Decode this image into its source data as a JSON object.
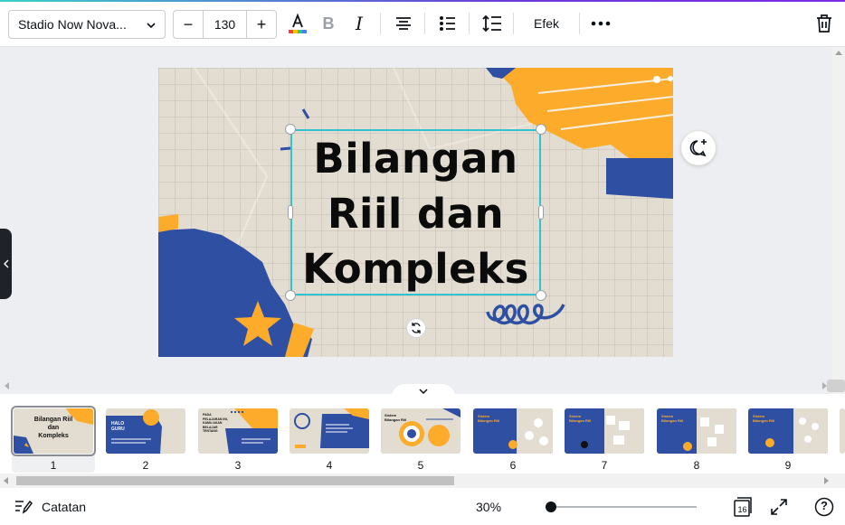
{
  "toolbar": {
    "font_name": "Stadio Now Nova...",
    "font_size": "130",
    "decrease_label": "−",
    "increase_label": "+",
    "effects_label": "Efek",
    "text_color_accent": "#ff3d3d",
    "icons": [
      "text-color-icon",
      "bold-icon",
      "italic-icon",
      "align-center-icon",
      "list-icon",
      "spacing-icon",
      "more-icon",
      "trash-icon"
    ]
  },
  "slide": {
    "title_lines": [
      "Bilangan",
      "Riil dan",
      "Kompleks"
    ],
    "colors": {
      "orange": "#fdab2b",
      "blue": "#2f4fa3",
      "paper": "#e3ddd1"
    }
  },
  "thumbnails": [
    {
      "num": "1",
      "text": "Bilangan Riil dan Kompleks",
      "active": true
    },
    {
      "num": "2",
      "text": "HALO GURU"
    },
    {
      "num": "3",
      "text": "PADA PELAJARAN INI, KAMU AKAN BELAJAR TENTANG"
    },
    {
      "num": "4",
      "text": ""
    },
    {
      "num": "5",
      "text": "Sistem Bilangan Riil"
    },
    {
      "num": "6",
      "text": "Sistem Bilangan Riil"
    },
    {
      "num": "7",
      "text": "Sistem Bilangan Riil"
    },
    {
      "num": "8",
      "text": "Sistem Bilangan Riil"
    },
    {
      "num": "9",
      "text": "Sistem Bilangan Riil"
    }
  ],
  "bottombar": {
    "notes_label": "Catatan",
    "zoom": "30%",
    "zoom_fraction": 0.0,
    "page_count": "16",
    "help_label": "?"
  }
}
